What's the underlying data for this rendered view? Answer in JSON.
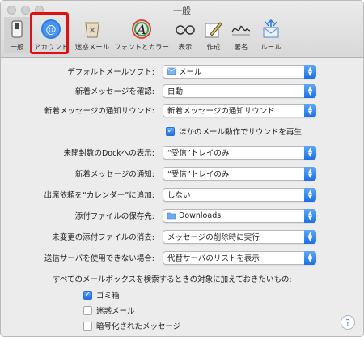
{
  "window": {
    "title": "一般"
  },
  "toolbar": [
    {
      "id": "general",
      "label": "一般",
      "icon": "switch-icon"
    },
    {
      "id": "accounts",
      "label": "アカウント",
      "icon": "at-icon"
    },
    {
      "id": "junk",
      "label": "迷惑メール",
      "icon": "trash-icon"
    },
    {
      "id": "fonts",
      "label": "フォントとカラー",
      "icon": "font-icon"
    },
    {
      "id": "viewing",
      "label": "表示",
      "icon": "glasses-icon"
    },
    {
      "id": "composing",
      "label": "作成",
      "icon": "pencil-icon"
    },
    {
      "id": "signatures",
      "label": "署名",
      "icon": "signature-icon"
    },
    {
      "id": "rules",
      "label": "ルール",
      "icon": "envelope-icon"
    }
  ],
  "settings": {
    "default_mail": {
      "label": "デフォルトメールソフト:",
      "value": "メール"
    },
    "check_new": {
      "label": "新着メッセージを確認:",
      "value": "自動"
    },
    "new_sound": {
      "label": "新着メッセージの通知サウンド:",
      "value": "新着メッセージの通知サウンド"
    },
    "play_sounds": {
      "label": "ほかのメール動作でサウンドを再生",
      "checked": true
    },
    "dock_unread": {
      "label": "未開封数のDockへの表示:",
      "value": "“受信”トレイのみ"
    },
    "notifications": {
      "label": "新着メッセージの通知:",
      "value": "“受信”トレイのみ"
    },
    "invites": {
      "label": "出席依頼を“カレンダー”に追加:",
      "value": "しない"
    },
    "downloads": {
      "label": "添付ファイルの保存先:",
      "value": "Downloads"
    },
    "remove_attach": {
      "label": "未変更の添付ファイルの消去:",
      "value": "メッセージの削除時に実行"
    },
    "server_unavail": {
      "label": "送信サーバを使用できない場合:",
      "value": "代替サーバのリストを表示"
    }
  },
  "search_section": {
    "heading": "すべてのメールボックスを検索するときの対象に加えておきたいもの:",
    "options": [
      {
        "label": "ゴミ箱",
        "checked": true
      },
      {
        "label": "迷惑メール",
        "checked": false
      },
      {
        "label": "暗号化されたメッセージ",
        "checked": false
      }
    ]
  },
  "help": {
    "label": "?"
  },
  "colors": {
    "accent": "#1d6fe6",
    "highlight": "#e01010"
  }
}
